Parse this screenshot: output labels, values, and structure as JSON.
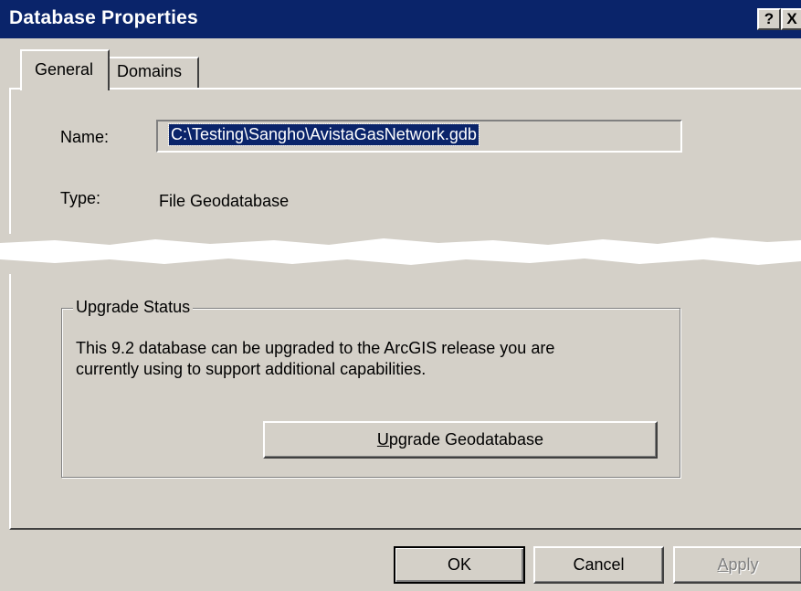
{
  "window": {
    "title": "Database Properties",
    "help_label": "?",
    "close_label": "X"
  },
  "tabs": [
    {
      "label": "General",
      "selected": true
    },
    {
      "label": "Domains",
      "selected": false
    }
  ],
  "general": {
    "name_label": "Name:",
    "name_value": "C:\\Testing\\Sangho\\AvistaGasNetwork.gdb",
    "type_label": "Type:",
    "type_value": "File Geodatabase"
  },
  "upgrade_status": {
    "legend": "Upgrade Status",
    "message_line1": "This 9.2 database can be upgraded to the ArcGIS release you are",
    "message_line2": "currently using to support additional capabilities.",
    "button_accel": "U",
    "button_rest": "pgrade Geodatabase"
  },
  "footer": {
    "ok_label": "OK",
    "cancel_label": "Cancel",
    "apply_accel": "A",
    "apply_rest": "pply",
    "apply_enabled": false
  },
  "colors": {
    "titlebar": "#0a246a",
    "face": "#d4d0c8",
    "selection": "#0a246a"
  }
}
